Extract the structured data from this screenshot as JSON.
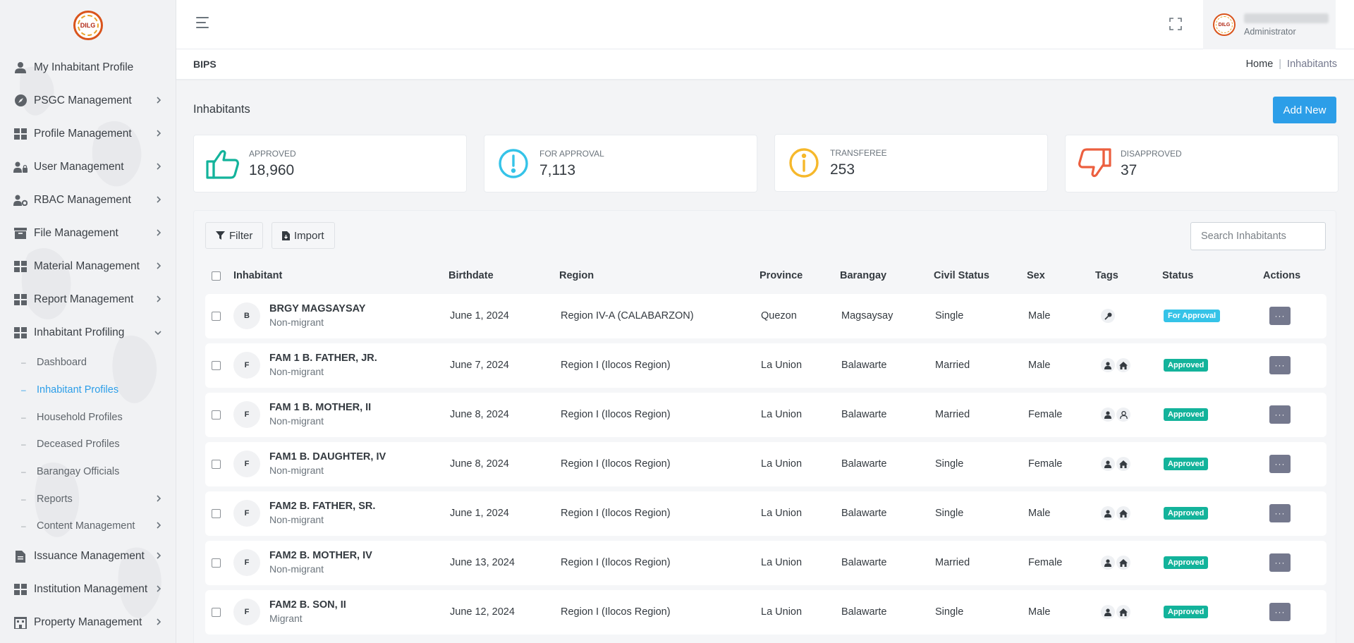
{
  "sidebar": {
    "logo_text": "DILG",
    "items": [
      {
        "label": "My Inhabitant Profile",
        "icon": "user-icon",
        "chevron": false
      },
      {
        "label": "PSGC Management",
        "icon": "compass-icon",
        "chevron": true
      },
      {
        "label": "Profile Management",
        "icon": "grid-icon",
        "chevron": true
      },
      {
        "label": "User Management",
        "icon": "users-lock-icon",
        "chevron": true
      },
      {
        "label": "RBAC Management",
        "icon": "user-gear-icon",
        "chevron": true
      },
      {
        "label": "File Management",
        "icon": "archive-icon",
        "chevron": true
      },
      {
        "label": "Material Management",
        "icon": "grid-icon",
        "chevron": true
      },
      {
        "label": "Report Management",
        "icon": "grid-icon",
        "chevron": true
      },
      {
        "label": "Inhabitant Profiling",
        "icon": "grid-icon",
        "chevron": true,
        "expanded": true
      }
    ],
    "sub_items": [
      {
        "label": "Dashboard",
        "active": false,
        "chevron": false
      },
      {
        "label": "Inhabitant Profiles",
        "active": true,
        "chevron": false
      },
      {
        "label": "Household Profiles",
        "active": false,
        "chevron": false
      },
      {
        "label": "Deceased Profiles",
        "active": false,
        "chevron": false
      },
      {
        "label": "Barangay Officials",
        "active": false,
        "chevron": false
      },
      {
        "label": "Reports",
        "active": false,
        "chevron": true
      },
      {
        "label": "Content Management",
        "active": false,
        "chevron": true
      }
    ],
    "bottom_items": [
      {
        "label": "Issuance Management",
        "icon": "file-icon",
        "chevron": true
      },
      {
        "label": "Institution Management",
        "icon": "grid-icon",
        "chevron": true
      },
      {
        "label": "Property Management",
        "icon": "building-icon",
        "chevron": true
      }
    ]
  },
  "topbar": {
    "user_role": "Administrator",
    "avatar_text": "DILG"
  },
  "breadcrumb": {
    "app": "BIPS",
    "home": "Home",
    "separator": "|",
    "current": "Inhabitants"
  },
  "main": {
    "title": "Inhabitants",
    "add_button": "Add New",
    "stats": [
      {
        "label": "APPROVED",
        "value": "18,960",
        "icon": "thumbs-up-icon",
        "color": "#13b39b"
      },
      {
        "label": "FOR APPROVAL",
        "value": "7,113",
        "icon": "exclamation-circle-icon",
        "color": "#35c3e8"
      },
      {
        "label": "TRANSFEREE",
        "value": "253",
        "icon": "info-circle-icon",
        "color": "#f6b82b"
      },
      {
        "label": "DISAPPROVED",
        "value": "37",
        "icon": "thumbs-down-icon",
        "color": "#ec5f3f"
      }
    ],
    "toolbar": {
      "filter_label": "Filter",
      "import_label": "Import",
      "search_placeholder": "Search Inhabitants"
    },
    "columns": [
      "Inhabitant",
      "Birthdate",
      "Region",
      "Province",
      "Barangay",
      "Civil Status",
      "Sex",
      "Tags",
      "Status",
      "Actions"
    ],
    "status_colors": {
      "For Approval": "#35c3e8",
      "Approved": "#13b39b"
    },
    "action_label": "···",
    "rows": [
      {
        "initial": "B",
        "name": "BRGY MAGSAYSAY",
        "migration": "Non-migrant",
        "birthdate": "June 1, 2024",
        "region": "Region IV-A (CALABARZON)",
        "province": "Quezon",
        "barangay": "Magsaysay",
        "civil_status": "Single",
        "sex": "Male",
        "tags": [
          "key-icon"
        ],
        "status": "For Approval"
      },
      {
        "initial": "F",
        "name": "FAM 1 B. FATHER, JR.",
        "migration": "Non-migrant",
        "birthdate": "June 7, 2024",
        "region": "Region I (Ilocos Region)",
        "province": "La Union",
        "barangay": "Balawarte",
        "civil_status": "Married",
        "sex": "Male",
        "tags": [
          "person-icon",
          "home-icon"
        ],
        "status": "Approved"
      },
      {
        "initial": "F",
        "name": "FAM 1 B. MOTHER, II",
        "migration": "Non-migrant",
        "birthdate": "June 8, 2024",
        "region": "Region I (Ilocos Region)",
        "province": "La Union",
        "barangay": "Balawarte",
        "civil_status": "Married",
        "sex": "Female",
        "tags": [
          "person-icon",
          "person-circle-icon"
        ],
        "status": "Approved"
      },
      {
        "initial": "F",
        "name": "FAM1 B. DAUGHTER, IV",
        "migration": "Non-migrant",
        "birthdate": "June 8, 2024",
        "region": "Region I (Ilocos Region)",
        "province": "La Union",
        "barangay": "Balawarte",
        "civil_status": "Single",
        "sex": "Female",
        "tags": [
          "person-icon",
          "home-icon"
        ],
        "status": "Approved"
      },
      {
        "initial": "F",
        "name": "FAM2 B. FATHER, SR.",
        "migration": "Non-migrant",
        "birthdate": "June 1, 2024",
        "region": "Region I (Ilocos Region)",
        "province": "La Union",
        "barangay": "Balawarte",
        "civil_status": "Single",
        "sex": "Male",
        "tags": [
          "person-icon",
          "home-icon"
        ],
        "status": "Approved"
      },
      {
        "initial": "F",
        "name": "FAM2 B. MOTHER, IV",
        "migration": "Non-migrant",
        "birthdate": "June 13, 2024",
        "region": "Region I (Ilocos Region)",
        "province": "La Union",
        "barangay": "Balawarte",
        "civil_status": "Married",
        "sex": "Female",
        "tags": [
          "person-icon",
          "home-icon"
        ],
        "status": "Approved"
      },
      {
        "initial": "F",
        "name": "FAM2 B. SON, II",
        "migration": "Migrant",
        "birthdate": "June 12, 2024",
        "region": "Region I (Ilocos Region)",
        "province": "La Union",
        "barangay": "Balawarte",
        "civil_status": "Single",
        "sex": "Male",
        "tags": [
          "person-icon",
          "home-icon"
        ],
        "status": "Approved"
      }
    ]
  }
}
